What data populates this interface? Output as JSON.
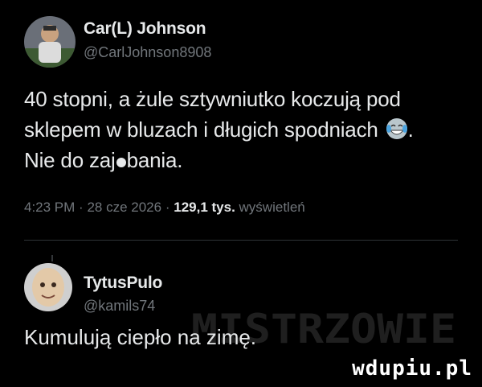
{
  "tweet": {
    "author_name": "Car(L) Johnson",
    "author_handle": "@CarlJohnson8908",
    "text_line1": "40 stopni, a żule sztywniutko koczują pod",
    "text_line2": "sklepem w bluzach i długich spodniach",
    "text_line2_end": ".",
    "text_line3_start": "Nie do zaj",
    "text_line3_end": "bania.",
    "emoji": "face-with-tears-of-joy-icon",
    "time": "4:23 PM",
    "separator": "·",
    "date": "28 cze 2026",
    "views_count": "129,1 tys.",
    "views_label": "wyświetleń"
  },
  "reply": {
    "author_name": "TytusPulo",
    "author_handle": "@kamils74",
    "text": "Kumulują ciepło na zimę."
  },
  "watermarks": {
    "overlay_text": "MISTRZOWIE",
    "site": "wdupiu.pl"
  },
  "colors": {
    "background": "#000000",
    "primary_text": "#e7e9ea",
    "secondary_text": "#71767b",
    "divider": "#2f3336"
  }
}
